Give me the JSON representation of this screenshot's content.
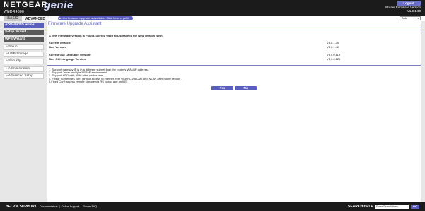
{
  "header": {
    "brand": "NETGEAR",
    "product": "genie",
    "model": "WNDR4300",
    "logout_label": "Logout",
    "firmware_label": "Router Firmware Version",
    "firmware_version": "V1.0.1.30"
  },
  "tabs": {
    "basic": "BASIC",
    "advanced": "ADVANCED"
  },
  "notice": "New firmware upgrade is available. Click here to get it",
  "language": "Auto",
  "sidebar": {
    "items": [
      "ADVANCED Home",
      "Setup Wizard",
      "WPS Wizard",
      "» Setup",
      "» USB Storage",
      "» Security",
      "» Administration",
      "» Advanced Setup"
    ]
  },
  "main": {
    "title": "Firmware Upgrade Assistant",
    "question": "A New Firmware Version is Found, Do You Want to Upgrade to the New Version Now?",
    "rows": [
      {
        "label": "Current Version:",
        "value": "V1.0.1.30"
      },
      {
        "label": "New Version:",
        "value": "V1.0.1.42"
      },
      {
        "label": "Current GUI Language Version:",
        "value": "V1.0.0.119"
      },
      {
        "label": "New GUI Language Version:",
        "value": "V1.0.0.125"
      }
    ],
    "notes": [
      "1. Support gateway IP is in a different subnet than the router's WAN IP address.",
      "2. Support Japan multiple PPPoE environment.",
      "3. Support HDD with 4096 bites sector size.",
      "4. Fixed \"Sometimes can't ping or access to internet from your PC via LAN and WLAN after router reboot\".",
      "5.Fixed Can't access remote storage via RS_cloud app on iOS."
    ],
    "yes_label": "Yes",
    "no_label": "No"
  },
  "footer": {
    "help_title": "HELP & SUPPORT",
    "links": [
      "Documentation",
      "Online Support",
      "Router FAQ"
    ],
    "search_label": "SEARCH HELP",
    "search_placeholder": "Enter Search Item",
    "go_label": "GO"
  }
}
